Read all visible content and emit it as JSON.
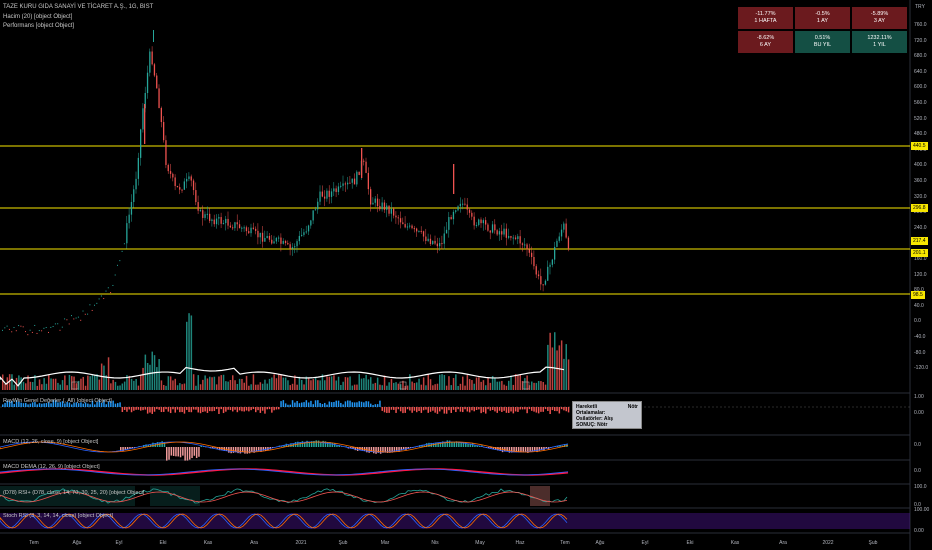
{
  "header": {
    "symbol": "TAZE KURU GIDA SANAYİ VE TİCARET A.Ş., 1G, BIST",
    "volume_label": "Hacim (20) [object Object]",
    "perf_label": "Performans [object Object]"
  },
  "currency": "TRY",
  "performance": [
    {
      "value": "-11.77%",
      "period": "1 HAFTA",
      "type": "neg"
    },
    {
      "value": "-0.5%",
      "period": "1 AY",
      "type": "neg"
    },
    {
      "value": "-5.89%",
      "period": "3 AY",
      "type": "neg"
    },
    {
      "value": "-8.62%",
      "period": "6 AY",
      "type": "neg"
    },
    {
      "value": "0.51%",
      "period": "BU YIL",
      "type": "pos"
    },
    {
      "value": "1232.11%",
      "period": "1 YIL",
      "type": "pos"
    }
  ],
  "price_axis": [
    "760.0",
    "720.0",
    "680.0",
    "640.0",
    "600.0",
    "560.0",
    "520.0",
    "480.0",
    "440.0",
    "400.0",
    "360.0",
    "320.0",
    "280.0",
    "240.0",
    "200.0",
    "160.0",
    "120.0",
    "80.0",
    "40.0",
    "0.0",
    "-40.0",
    "-80.0",
    "-120.0"
  ],
  "price_tags": [
    "440.5",
    "296.8",
    "217.4",
    "201.1",
    "98.5"
  ],
  "pane_labels": {
    "raywin": "RayWin Genel Değerler (, All) [object Object]",
    "macd": "MACD (12, 26, close, 9) [object Object]",
    "macd_dema": "MACD DEMA (12, 26, 9) [object Object]",
    "rsi": "(D78) RSI+ (D78, close, 14, 70, 30, 25, 20) [object Object]",
    "stoch": "Stoch RSI (3, 3, 14, 14, close) [object Object]"
  },
  "pane_axes": {
    "raywin": [
      "1.00",
      "0.00"
    ],
    "macd": [
      "0.0"
    ],
    "macd_dema": [
      "0.0"
    ],
    "rsi": [
      "100.0",
      "0.0"
    ],
    "stoch": [
      "100.00",
      "0.00"
    ]
  },
  "tooltip": {
    "rows": [
      {
        "k": "Hareketli Ortalamalar:",
        "v": "Nötr"
      },
      {
        "k": "Osilatörler: Alış",
        "v": ""
      },
      {
        "k": "SONUÇ: Nötr",
        "v": ""
      }
    ]
  },
  "time_axis": [
    "Tem",
    "Ağu",
    "Eyl",
    "Eki",
    "Kas",
    "Ara",
    "2021",
    "Şub",
    "Mar",
    "Nis",
    "May",
    "Haz",
    "Tem",
    "Ağu",
    "Eyl",
    "Eki",
    "Kas",
    "Ara",
    "2022",
    "Şub"
  ]
}
